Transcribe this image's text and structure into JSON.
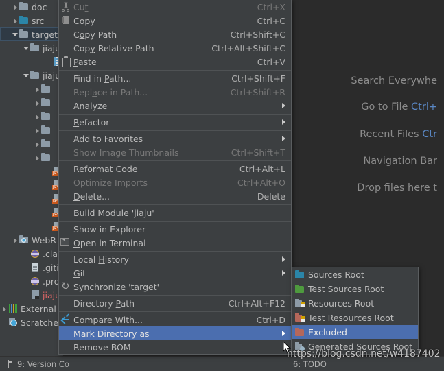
{
  "app": {
    "theme_bg": "#3c3f41",
    "editor_bg": "#2b2b2b",
    "highlight": "#4b6eaf",
    "text": "#bbbbbb",
    "disabled_text": "#787878"
  },
  "project_tree": {
    "items": [
      {
        "label": "doc",
        "indent": 1,
        "arrow": "right",
        "icon": "folder-icon",
        "selected": false
      },
      {
        "label": "src",
        "indent": 1,
        "arrow": "right",
        "icon": "folder-blue-icon",
        "selected": false
      },
      {
        "label": "target",
        "indent": 1,
        "arrow": "down",
        "icon": "folder-icon",
        "selected": true
      },
      {
        "label": "jiaju",
        "indent": 2,
        "arrow": "down",
        "icon": "folder-icon",
        "selected": false
      },
      {
        "label": ".",
        "indent": 4,
        "arrow": "none",
        "icon": "archive-icon",
        "selected": false
      },
      {
        "label": "jiaju",
        "indent": 2,
        "arrow": "down",
        "icon": "folder-icon",
        "selected": false
      },
      {
        "label": "",
        "indent": 3,
        "arrow": "right",
        "icon": "folder-icon",
        "selected": false
      },
      {
        "label": "",
        "indent": 3,
        "arrow": "right",
        "icon": "folder-icon",
        "selected": false
      },
      {
        "label": "",
        "indent": 3,
        "arrow": "right",
        "icon": "folder-icon",
        "selected": false
      },
      {
        "label": "",
        "indent": 3,
        "arrow": "right",
        "icon": "folder-icon",
        "selected": false
      },
      {
        "label": "",
        "indent": 3,
        "arrow": "right",
        "icon": "folder-icon",
        "selected": false
      },
      {
        "label": "",
        "indent": 3,
        "arrow": "right",
        "icon": "folder-icon",
        "selected": false
      },
      {
        "label": "",
        "indent": 4,
        "arrow": "none",
        "icon": "jsp-file-icon",
        "selected": false
      },
      {
        "label": "",
        "indent": 4,
        "arrow": "none",
        "icon": "jsp-file-icon",
        "selected": false
      },
      {
        "label": "",
        "indent": 4,
        "arrow": "none",
        "icon": "jsp-file-icon",
        "selected": false
      },
      {
        "label": "",
        "indent": 4,
        "arrow": "none",
        "icon": "jsp-file-icon",
        "selected": false
      },
      {
        "label": "",
        "indent": 4,
        "arrow": "none",
        "icon": "jsp-file-icon",
        "selected": false
      },
      {
        "label": "WebR",
        "indent": 1,
        "arrow": "right",
        "icon": "web-resource-icon",
        "selected": false
      },
      {
        "label": ".classp",
        "indent": 2,
        "arrow": "none",
        "icon": "classpath-icon",
        "selected": false
      },
      {
        "label": ".gitign",
        "indent": 2,
        "arrow": "none",
        "icon": "text-file-icon",
        "selected": false
      },
      {
        "label": ".proje",
        "indent": 2,
        "arrow": "none",
        "icon": "classpath-icon",
        "selected": false
      },
      {
        "label": "jiaju.im",
        "indent": 2,
        "arrow": "none",
        "icon": "module-file-icon",
        "selected": false,
        "color": "module"
      },
      {
        "label": "External L",
        "indent": 0,
        "arrow": "right",
        "icon": "external-libs-icon",
        "selected": false
      },
      {
        "label": "Scratches",
        "indent": 0,
        "arrow": "none",
        "icon": "scratches-icon",
        "selected": false
      }
    ]
  },
  "editor_hints": {
    "lines": [
      {
        "text": "Search Everywhe",
        "shortcut": ""
      },
      {
        "text": "Go to File  ",
        "shortcut": "Ctrl+"
      },
      {
        "text": "Recent Files  ",
        "shortcut": "Ctr"
      },
      {
        "text": "Navigation Bar",
        "shortcut": ""
      },
      {
        "text": "Drop files here t",
        "shortcut": ""
      }
    ]
  },
  "context_menu": {
    "items": [
      {
        "label": "Cut",
        "mnemonic": "t",
        "accel": "Ctrl+X",
        "icon": "cut-icon",
        "disabled": true,
        "submenu": false
      },
      {
        "label": "Copy",
        "mnemonic": "C",
        "accel": "Ctrl+C",
        "icon": "copy-icon",
        "disabled": false,
        "submenu": false
      },
      {
        "label": "Copy Path",
        "mnemonic": "o",
        "accel": "Ctrl+Shift+C",
        "icon": "",
        "disabled": false,
        "submenu": false
      },
      {
        "label": "Copy Relative Path",
        "mnemonic": "y",
        "accel": "Ctrl+Alt+Shift+C",
        "icon": "",
        "disabled": false,
        "submenu": false
      },
      {
        "label": "Paste",
        "mnemonic": "P",
        "accel": "Ctrl+V",
        "icon": "paste-icon",
        "disabled": false,
        "submenu": false
      },
      {
        "separator": true
      },
      {
        "label": "Find in Path...",
        "mnemonic": "P",
        "accel": "Ctrl+Shift+F",
        "icon": "",
        "disabled": false,
        "submenu": false
      },
      {
        "label": "Replace in Path...",
        "mnemonic": "a",
        "accel": "Ctrl+Shift+R",
        "icon": "",
        "disabled": true,
        "submenu": false
      },
      {
        "label": "Analyze",
        "mnemonic": "y",
        "accel": "",
        "icon": "",
        "disabled": false,
        "submenu": true
      },
      {
        "separator": true
      },
      {
        "label": "Refactor",
        "mnemonic": "R",
        "accel": "",
        "icon": "",
        "disabled": false,
        "submenu": true
      },
      {
        "separator": true
      },
      {
        "label": "Add to Favorites",
        "mnemonic": "v",
        "accel": "",
        "icon": "",
        "disabled": false,
        "submenu": true
      },
      {
        "label": "Show Image Thumbnails",
        "mnemonic": "",
        "accel": "Ctrl+Shift+T",
        "icon": "",
        "disabled": true,
        "submenu": false
      },
      {
        "separator": true
      },
      {
        "label": "Reformat Code",
        "mnemonic": "R",
        "accel": "Ctrl+Alt+L",
        "icon": "",
        "disabled": false,
        "submenu": false
      },
      {
        "label": "Optimize Imports",
        "mnemonic": "z",
        "accel": "Ctrl+Alt+O",
        "icon": "",
        "disabled": true,
        "submenu": false
      },
      {
        "label": "Delete...",
        "mnemonic": "D",
        "accel": "Delete",
        "icon": "",
        "disabled": false,
        "submenu": false
      },
      {
        "separator": true
      },
      {
        "label": "Build Module 'jiaju'",
        "mnemonic": "M",
        "accel": "",
        "icon": "",
        "disabled": false,
        "submenu": false
      },
      {
        "separator": true
      },
      {
        "label": "Show in Explorer",
        "mnemonic": "",
        "accel": "",
        "icon": "",
        "disabled": false,
        "submenu": false
      },
      {
        "label": "Open in Terminal",
        "mnemonic": "O",
        "accel": "",
        "icon": "terminal-icon",
        "disabled": false,
        "submenu": false
      },
      {
        "separator": true
      },
      {
        "label": "Local History",
        "mnemonic": "H",
        "accel": "",
        "icon": "",
        "disabled": false,
        "submenu": true
      },
      {
        "label": "Git",
        "mnemonic": "G",
        "accel": "",
        "icon": "",
        "disabled": false,
        "submenu": true
      },
      {
        "label": "Synchronize 'target'",
        "mnemonic": "",
        "accel": "",
        "icon": "sync-icon",
        "disabled": false,
        "submenu": false
      },
      {
        "separator": true
      },
      {
        "label": "Directory Path",
        "mnemonic": "P",
        "accel": "Ctrl+Alt+F12",
        "icon": "",
        "disabled": false,
        "submenu": false
      },
      {
        "separator": true
      },
      {
        "label": "Compare With...",
        "mnemonic": "",
        "accel": "Ctrl+D",
        "icon": "compare-icon",
        "disabled": false,
        "submenu": false
      },
      {
        "label": "Mark Directory as",
        "mnemonic": "",
        "accel": "",
        "icon": "",
        "disabled": false,
        "submenu": true,
        "highlighted": true
      },
      {
        "label": "Remove BOM",
        "mnemonic": "",
        "accel": "",
        "icon": "",
        "disabled": false,
        "submenu": false
      }
    ]
  },
  "submenu": {
    "items": [
      {
        "label": "Sources Root",
        "icon": "folder-blue-icon",
        "highlighted": false
      },
      {
        "label": "Test Sources Root",
        "icon": "folder-green-icon",
        "highlighted": false
      },
      {
        "label": "Resources Root",
        "icon": "resources-icon",
        "highlighted": false
      },
      {
        "label": "Test Resources Root",
        "icon": "test-resources-icon",
        "highlighted": false
      },
      {
        "label": "Excluded",
        "icon": "folder-red-icon",
        "highlighted": true
      },
      {
        "label": "Generated Sources Root",
        "icon": "generated-sources-icon",
        "highlighted": false
      }
    ]
  },
  "status_bar": {
    "version_control": "9: Version Co",
    "todo": "6: TODO"
  },
  "watermark": {
    "text": "https://blog.csdn.net/w4187402"
  }
}
